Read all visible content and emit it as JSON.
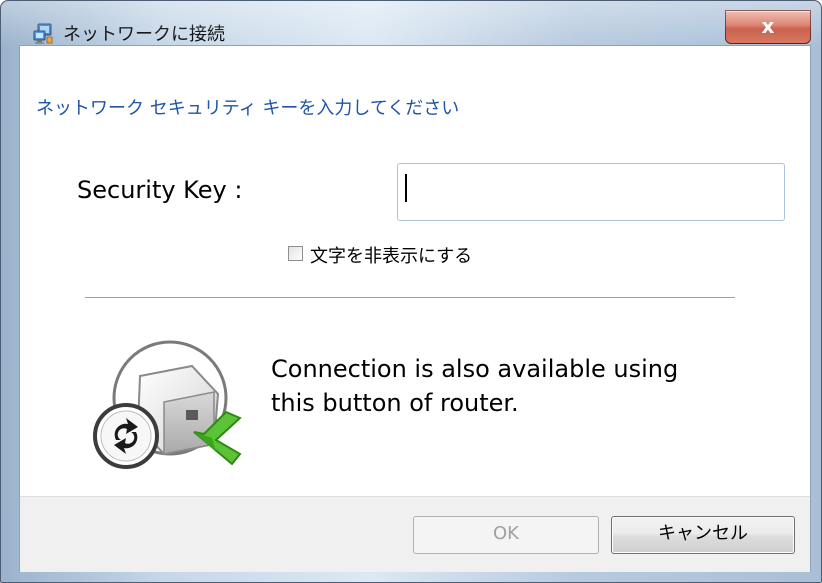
{
  "window": {
    "title": "ネットワークに接続",
    "close_label": "x",
    "title_icon": "network-computer-icon"
  },
  "dialog": {
    "instruction": "ネットワーク セキュリティ キーを入力してください",
    "security_key": {
      "label": "Security Key :",
      "value": "",
      "placeholder": ""
    },
    "hide_characters": {
      "label": "文字を非表示にする",
      "checked": false
    },
    "wps": {
      "icon": "wps-router-button-icon",
      "line1": "Connection is also available using",
      "line2": "this button of router."
    }
  },
  "buttons": {
    "ok": "OK",
    "ok_enabled": false,
    "cancel": "キャンセル"
  },
  "colors": {
    "instruction_text": "#1f55a6",
    "close_button": "#c9553f",
    "wps_arrow": "#4caf2a"
  }
}
